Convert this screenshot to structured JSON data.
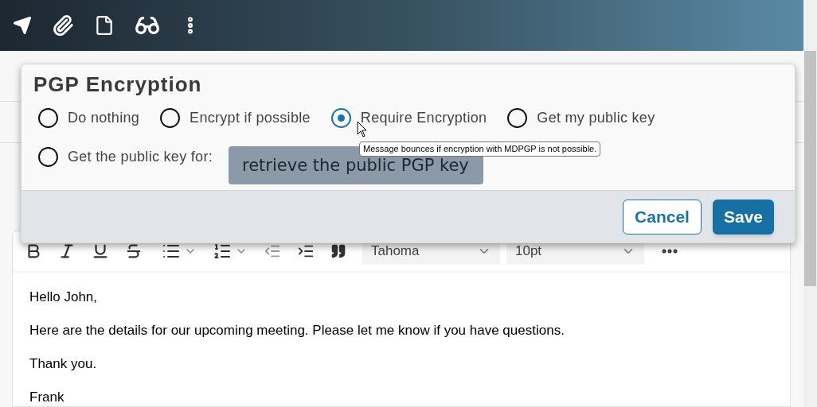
{
  "dialog": {
    "title": "PGP Encryption",
    "options": [
      {
        "kind": "radio",
        "label": "Do nothing",
        "selected": false
      },
      {
        "kind": "radio",
        "label": "Encrypt if possible",
        "selected": false
      },
      {
        "kind": "radio",
        "label": "Require Encryption",
        "selected": true
      },
      {
        "kind": "radio",
        "label": "Get my public key",
        "selected": false
      },
      {
        "kind": "radio_with_field",
        "label": "Get the public key for:",
        "selected": false,
        "value": "retrieve the public PGP key"
      }
    ],
    "tooltip": "Message bounces if encryption with MDPGP is not possible.",
    "buttons": [
      {
        "kind": "secondary",
        "label": "Cancel"
      },
      {
        "kind": "primary",
        "label": "Save"
      }
    ]
  },
  "editor": {
    "font": "Tahoma",
    "size": "10pt",
    "paragraphs": [
      "Hello John,",
      "Here are the details for our upcoming meeting. Please let me know if you have questions.",
      "Thank you.",
      "Frank"
    ]
  }
}
